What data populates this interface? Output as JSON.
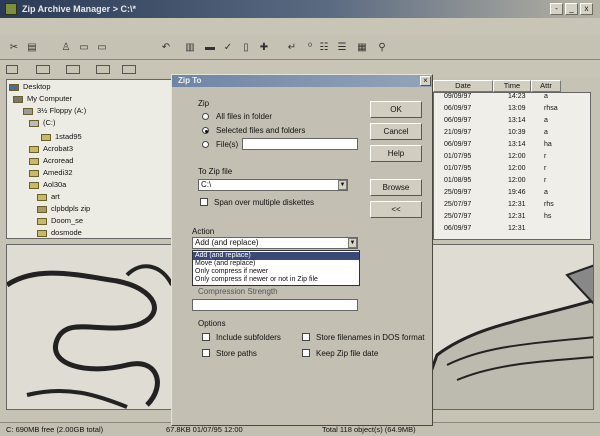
{
  "window": {
    "title": "Zip Archive Manager > C:\\*",
    "controls": [
      "-",
      "_",
      "x"
    ]
  },
  "menubar": {
    "items": [
      "",
      "",
      "",
      "",
      ""
    ]
  },
  "toolbar": {
    "icons": [
      "cut-icon",
      "copy-icon",
      "paste-icon",
      "delete-icon",
      "undo-icon",
      "view-icon",
      "up-icon",
      "check-icon",
      "add-icon",
      "extract-icon",
      "sort-icon",
      "list-icon",
      "grid-icon",
      "find-icon"
    ]
  },
  "address": {
    "items": [
      "",
      "",
      "",
      ""
    ]
  },
  "tree": {
    "items": [
      {
        "label": "Desktop"
      },
      {
        "label": "My Computer"
      },
      {
        "label": "3½ Floppy (A:)"
      },
      {
        "label": "(C:)"
      },
      {
        "label": "1stad95"
      },
      {
        "label": "Acrobat3"
      },
      {
        "label": "Acroread"
      },
      {
        "label": "Amedi32"
      },
      {
        "label": "Aol30a"
      },
      {
        "label": "art"
      },
      {
        "label": "clpbdpls zip"
      },
      {
        "label": "Doom_se"
      },
      {
        "label": "dosmode"
      }
    ]
  },
  "filelist": {
    "columns": [
      "Date",
      "Time",
      "Attr"
    ],
    "rows": [
      {
        "date": "09/09/97",
        "time": "14:23",
        "attr": "a"
      },
      {
        "date": "06/09/97",
        "time": "13:09",
        "attr": "rhsa"
      },
      {
        "date": "06/09/97",
        "time": "13:14",
        "attr": "a"
      },
      {
        "date": "21/09/97",
        "time": "10:39",
        "attr": "a"
      },
      {
        "date": "06/09/97",
        "time": "13:14",
        "attr": "ha"
      },
      {
        "date": "01/07/95",
        "time": "12:00",
        "attr": "r"
      },
      {
        "date": "01/07/95",
        "time": "12:00",
        "attr": "r"
      },
      {
        "date": "01/08/95",
        "time": "12:00",
        "attr": "r"
      },
      {
        "date": "25/09/97",
        "time": "19:46",
        "attr": "a"
      },
      {
        "date": "25/07/97",
        "time": "12:31",
        "attr": "rhs"
      },
      {
        "date": "25/07/97",
        "time": "12:31",
        "attr": "hs"
      },
      {
        "date": "06/09/97",
        "time": "12:31",
        "attr": ""
      }
    ]
  },
  "dialog": {
    "title": "Zip To",
    "zip_group_label": "Zip",
    "radio_all": "All files in folder",
    "radio_selected": "Selected files and folders",
    "radio_files": "File(s)",
    "files_value": "",
    "ok": "OK",
    "cancel": "Cancel",
    "help": "Help",
    "to_zip_label": "To Zip file",
    "to_zip_value": "C:\\",
    "browse": "Browse",
    "back": "<<",
    "span_label": "Span over multiple diskettes",
    "action_label": "Action",
    "action_value": "Add (and replace)",
    "action_options": [
      "Add (and replace)",
      "Move (and replace)",
      "Only compress if newer",
      "Only compress if newer or not in Zip file"
    ],
    "compression_label": "Compression Strength",
    "options_label": "Options",
    "include_subfolders": "Include subfolders",
    "store_dos": "Store filenames in DOS format",
    "store_paths": "Store paths",
    "keep_date": "Keep Zip file date"
  },
  "status": {
    "free": "C: 690MB free (2.00GB total)",
    "selected": "67.8KB   01/07/95  12:00",
    "total": "Total 118 object(s) (64.9MB)"
  },
  "colors": {
    "title_bar": "#2b3a55",
    "dialog_title": "#6f85a6",
    "selection": "#3a4a78"
  }
}
